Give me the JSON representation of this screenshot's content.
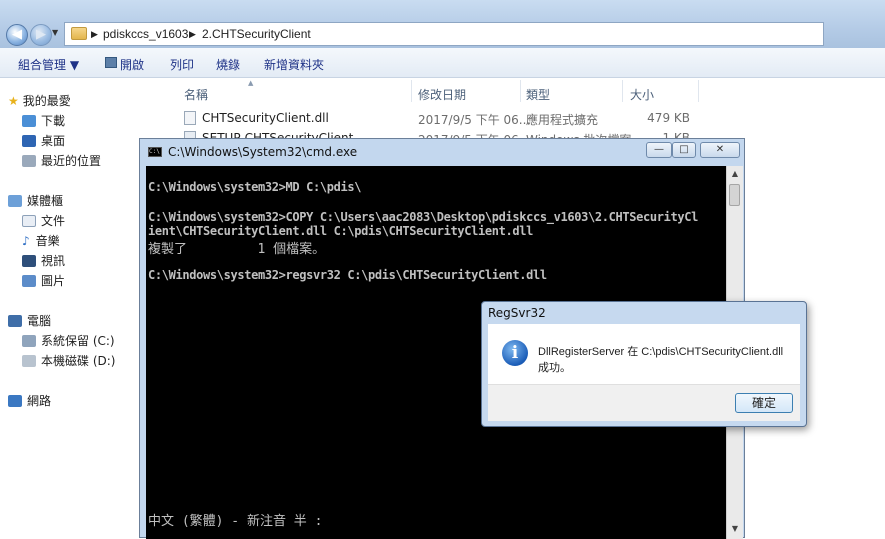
{
  "explorer": {
    "breadcrumb": [
      "pdiskccs_v1603",
      "2.CHTSecurityClient"
    ],
    "toolbar": [
      "組合管理 ▼",
      "開啟",
      "列印",
      "燒錄",
      "新增資料夾"
    ],
    "nav": {
      "favorites": "我的最愛",
      "downloads": "下載",
      "desktop": "桌面",
      "recent": "最近的位置",
      "libraries": "媒體櫃",
      "documents": "文件",
      "music": "音樂",
      "videos": "視訊",
      "pictures": "圖片",
      "computer": "電腦",
      "drive_c": "系統保留 (C:)",
      "drive_d": "本機磁碟 (D:)",
      "network": "網路"
    },
    "columns": [
      "名稱",
      "修改日期",
      "類型",
      "大小"
    ],
    "files": [
      {
        "name": "CHTSecurityClient.dll",
        "date": "2017/9/5 下午 06...",
        "type": "應用程式擴充",
        "size": "479 KB"
      },
      {
        "name": "SETUP-CHTSecurityClient",
        "date": "2017/9/5 下午 06...",
        "type": "Windows 批次檔案",
        "size": "1 KB"
      }
    ]
  },
  "cmd": {
    "title": "C:\\Windows\\System32\\cmd.exe",
    "lines": [
      "C:\\Windows\\system32>MD C:\\pdis\\",
      "C:\\Windows\\system32>COPY C:\\Users\\aac2083\\Desktop\\pdiskccs_v1603\\2.CHTSecurityCl",
      "ient\\CHTSecurityClient.dll C:\\pdis\\CHTSecurityClient.dll",
      "複製了         1 個檔案。",
      "C:\\Windows\\system32>regsvr32 C:\\pdis\\CHTSecurityClient.dll"
    ],
    "ime_status": "中文 (繁體) - 新注音 半 :"
  },
  "dialog": {
    "title": "RegSvr32",
    "message_line1": "DllRegisterServer 在 C:\\pdis\\CHTSecurityClient.dll",
    "message_line2": "成功。",
    "ok_label": "確定"
  }
}
